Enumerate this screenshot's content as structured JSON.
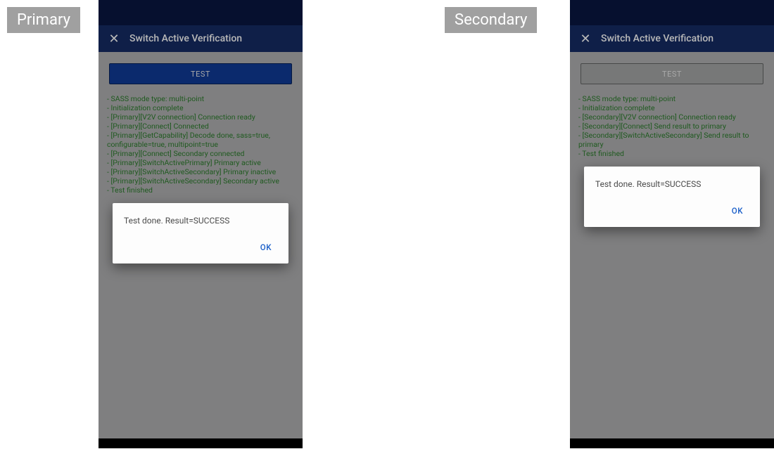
{
  "tags": {
    "primary": "Primary",
    "secondary": "Secondary"
  },
  "app_bar": {
    "title": "Switch Active Verification",
    "close": "✕"
  },
  "buttons": {
    "test": "TEST"
  },
  "dialog": {
    "message": "Test done. Result=SUCCESS",
    "ok": "OK"
  },
  "primary_log": [
    "- SASS mode type: multi-point",
    "- Initialization complete",
    "- [Primary][V2V connection] Connection ready",
    "- [Primary][Connect] Connected",
    "- [Primary][GetCapability] Decode done, sass=true, configurable=true, multipoint=true",
    "- [Primary][Connect] Secondary connected",
    "- [Primary][SwitchActivePrimary] Primary active",
    "- [Primary][SwitchActiveSecondary] Primary inactive",
    "- [Primary][SwitchActiveSecondary] Secondary active",
    "- Test finished"
  ],
  "secondary_log": [
    "- SASS mode type: multi-point",
    "- Initialization complete",
    "- [Secondary][V2V connection] Connection ready",
    "- [Secondary][Connect] Send result to primary",
    "- [Secondary][SwitchActiveSecondary] Send result to primary",
    "- Test finished"
  ]
}
